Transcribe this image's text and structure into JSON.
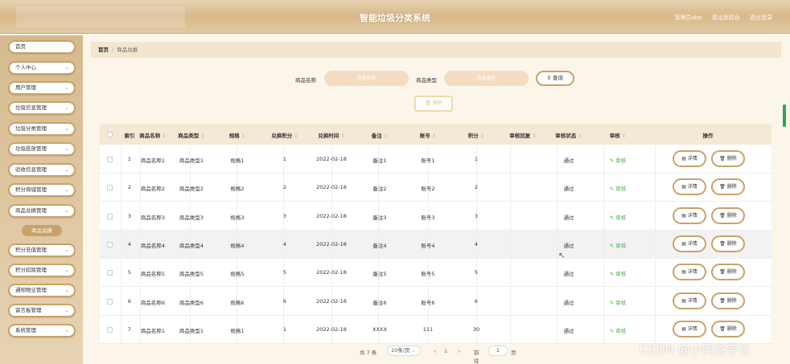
{
  "header": {
    "title": "智能垃圾分类系统",
    "user_label": "管理员abo",
    "exit_to_front": "退出到前台",
    "logout": "退出登录"
  },
  "sidebar": {
    "items": [
      {
        "label": "首页",
        "chevron": false
      },
      {
        "label": "个人中心",
        "chevron": true
      },
      {
        "label": "用户管理",
        "chevron": true
      },
      {
        "label": "垃圾信息管理",
        "chevron": true
      },
      {
        "label": "垃圾分类管理",
        "chevron": true
      },
      {
        "label": "垃圾投放管理",
        "chevron": true
      },
      {
        "label": "验收信息管理",
        "chevron": true
      },
      {
        "label": "积分商城管理",
        "chevron": true
      },
      {
        "label": "商品兑换管理",
        "chevron": true
      },
      {
        "label": "积分充值管理",
        "chevron": true
      },
      {
        "label": "积分扣除管理",
        "chevron": true
      },
      {
        "label": "通知物业管理",
        "chevron": true
      },
      {
        "label": "留言板管理",
        "chevron": true
      },
      {
        "label": "系统管理",
        "chevron": true
      }
    ],
    "sub_active": "商品兑换"
  },
  "breadcrumb": {
    "home": "首页",
    "separator": "/",
    "current": "商品兑换"
  },
  "search": {
    "name_label": "商品名称",
    "name_placeholder": "商品名称",
    "type_label": "商品类型",
    "type_placeholder": "商品类型",
    "query_button": "查询",
    "search_icon": "search-icon"
  },
  "actions": {
    "batch_delete": "删除"
  },
  "table": {
    "columns": [
      "索引",
      "商品名称",
      "商品类型",
      "规格",
      "兑换积分",
      "兑换时间",
      "备注",
      "账号",
      "积分",
      "审核回复",
      "审核状态",
      "审核",
      "操作"
    ],
    "sortable": [
      false,
      true,
      true,
      true,
      true,
      true,
      true,
      true,
      true,
      true,
      true,
      true,
      false
    ],
    "rows": [
      {
        "idx": "1",
        "name": "商品名称1",
        "type": "商品类型1",
        "spec": "规格1",
        "points": "1",
        "time": "2022-02-18",
        "note": "备注1",
        "account": "账号1",
        "score": "1",
        "reply": "",
        "status": "通过",
        "audit": "审核"
      },
      {
        "idx": "2",
        "name": "商品名称2",
        "type": "商品类型2",
        "spec": "规格2",
        "points": "2",
        "time": "2022-02-18",
        "note": "备注2",
        "account": "账号2",
        "score": "2",
        "reply": "",
        "status": "通过",
        "audit": "审核"
      },
      {
        "idx": "3",
        "name": "商品名称3",
        "type": "商品类型3",
        "spec": "规格3",
        "points": "3",
        "time": "2022-02-18",
        "note": "备注3",
        "account": "账号3",
        "score": "3",
        "reply": "",
        "status": "通过",
        "audit": "审核"
      },
      {
        "idx": "4",
        "name": "商品名称4",
        "type": "商品类型4",
        "spec": "规格4",
        "points": "4",
        "time": "2022-02-18",
        "note": "备注4",
        "account": "账号4",
        "score": "4",
        "reply": "",
        "status": "通过",
        "audit": "审核"
      },
      {
        "idx": "5",
        "name": "商品名称5",
        "type": "商品类型5",
        "spec": "规格5",
        "points": "5",
        "time": "2022-02-18",
        "note": "备注5",
        "account": "账号5",
        "score": "5",
        "reply": "",
        "status": "通过",
        "audit": "审核"
      },
      {
        "idx": "6",
        "name": "商品名称6",
        "type": "商品类型6",
        "spec": "规格6",
        "points": "6",
        "time": "2022-02-18",
        "note": "备注6",
        "account": "账号6",
        "score": "6",
        "reply": "",
        "status": "通过",
        "audit": "审核"
      },
      {
        "idx": "7",
        "name": "商品名称1",
        "type": "商品类型1",
        "spec": "规格1",
        "points": "1",
        "time": "2022-02-18",
        "note": "XXXX",
        "account": "111",
        "score": "30",
        "reply": "",
        "status": "通过",
        "audit": "审核"
      }
    ],
    "detail_button": "详情",
    "delete_button": "删除",
    "highlighted_row": 4
  },
  "pagination": {
    "total": "共 7 条",
    "page_size": "10条/页",
    "prev": "<",
    "current_page": "1",
    "next": ">",
    "goto_label": "前往",
    "goto_value": "1",
    "page_suffix": "页"
  },
  "watermark": "CSDN @小阿杰学长",
  "colors": {
    "accent": "#c9a26a",
    "header": "#d7b98a",
    "audit_link": "#4caf50",
    "scroll_thumb": "#2aa55a"
  }
}
